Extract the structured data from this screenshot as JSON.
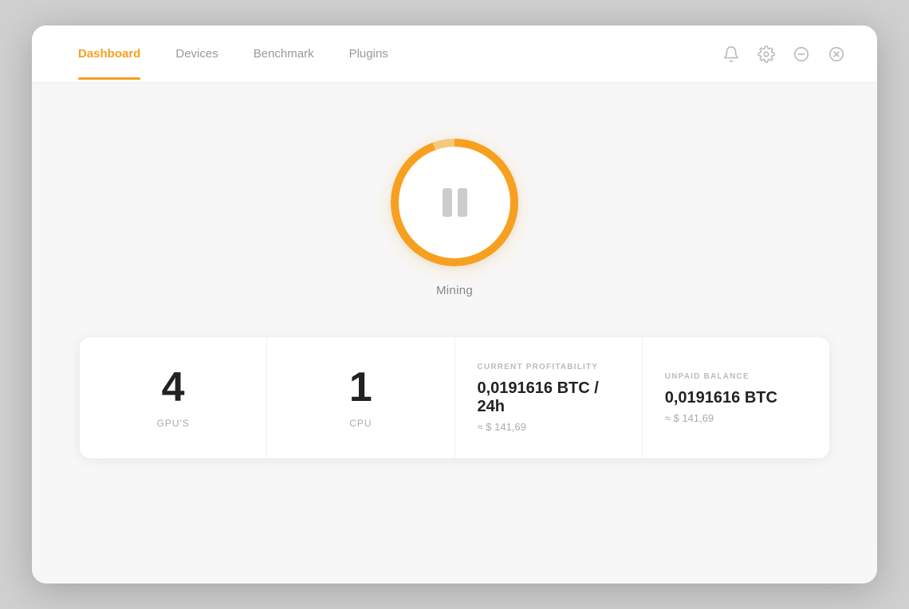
{
  "nav": {
    "items": [
      {
        "label": "Dashboard",
        "active": true
      },
      {
        "label": "Devices",
        "active": false
      },
      {
        "label": "Benchmark",
        "active": false
      },
      {
        "label": "Plugins",
        "active": false
      }
    ]
  },
  "header_icons": [
    {
      "name": "bell-icon",
      "symbol": "🔔"
    },
    {
      "name": "settings-icon",
      "symbol": "⚙"
    },
    {
      "name": "minimize-icon",
      "symbol": "⊖"
    },
    {
      "name": "close-icon",
      "symbol": "⊗"
    }
  ],
  "mining": {
    "status_label": "Mining",
    "button_label": "Pause Mining"
  },
  "stats": {
    "gpu_count": "4",
    "gpu_label": "GPU'S",
    "cpu_count": "1",
    "cpu_label": "CPU",
    "profitability": {
      "section_label": "CURRENT PROFITABILITY",
      "btc_value": "0,0191616",
      "btc_unit": " BTC / 24h",
      "usd_value": "≈ $ 141,69"
    },
    "balance": {
      "section_label": "UNPAID BALANCE",
      "btc_value": "0,0191616",
      "btc_unit": " BTC",
      "usd_value": "≈ $ 141,69"
    }
  },
  "colors": {
    "accent": "#f7a020",
    "text_dark": "#222",
    "text_muted": "#aaa",
    "border": "#f0f0f0"
  }
}
